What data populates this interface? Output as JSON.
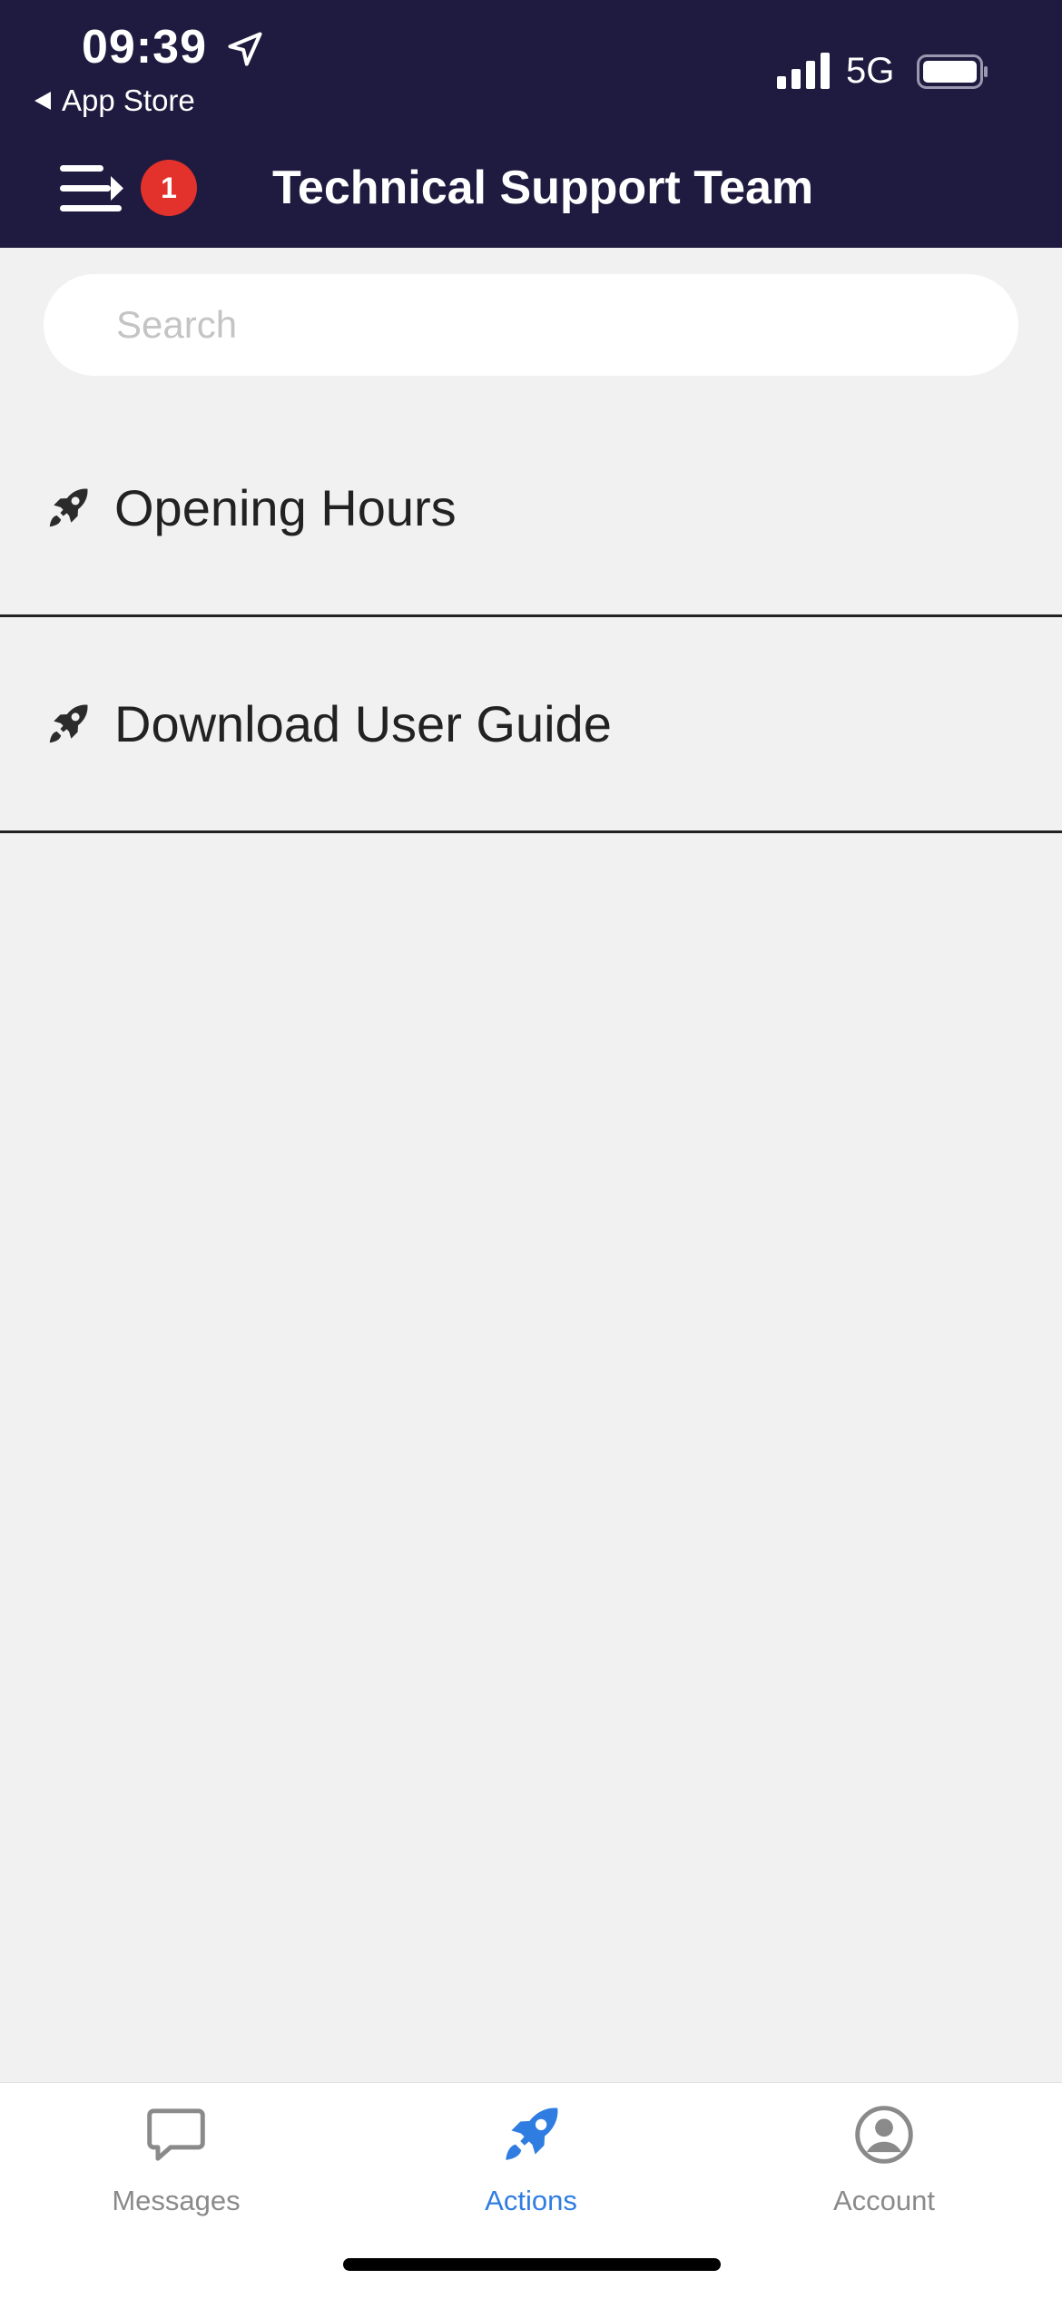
{
  "status_bar": {
    "time": "09:39",
    "back_label": "App Store",
    "network": "5G"
  },
  "header": {
    "title": "Technical Support Team",
    "notification_count": "1",
    "background": "#1f1a3f"
  },
  "search": {
    "placeholder": "Search",
    "value": ""
  },
  "actions": [
    {
      "label": "Opening Hours",
      "icon": "rocket-icon"
    },
    {
      "label": "Download User Guide",
      "icon": "rocket-icon"
    }
  ],
  "tabbar": {
    "tabs": [
      {
        "label": "Messages",
        "icon": "chat-bubble-icon",
        "active": false
      },
      {
        "label": "Actions",
        "icon": "rocket-icon",
        "active": true
      },
      {
        "label": "Account",
        "icon": "user-circle-icon",
        "active": false
      }
    ],
    "active_color": "#2f7de1",
    "inactive_color": "#8a8a8a"
  }
}
